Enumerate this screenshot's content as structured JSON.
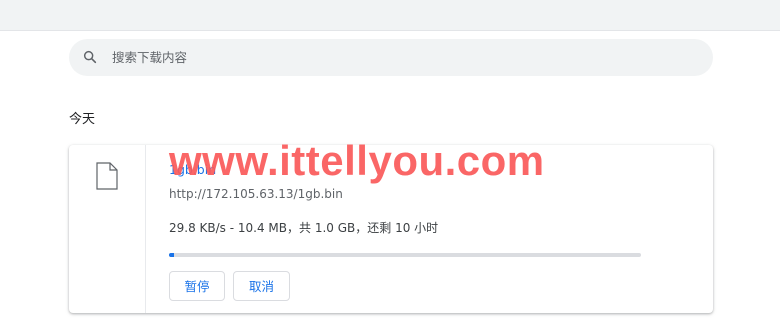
{
  "search": {
    "placeholder": "搜索下载内容",
    "icon": "search-icon"
  },
  "section": {
    "title": "今天"
  },
  "download": {
    "icon": "file-icon",
    "filename": "1gb.bin",
    "url": "http://172.105.63.13/1gb.bin",
    "status": "29.8 KB/s - 10.4 MB，共 1.0 GB，还剩 10 小时",
    "progress_fraction": 0.0104,
    "pause_label": "暂停",
    "cancel_label": "取消"
  },
  "watermark": {
    "text": "www.ittellyou.com"
  },
  "colors": {
    "accent": "#1a73e8",
    "watermark": "#fa5a5a",
    "track": "#dadce0"
  }
}
